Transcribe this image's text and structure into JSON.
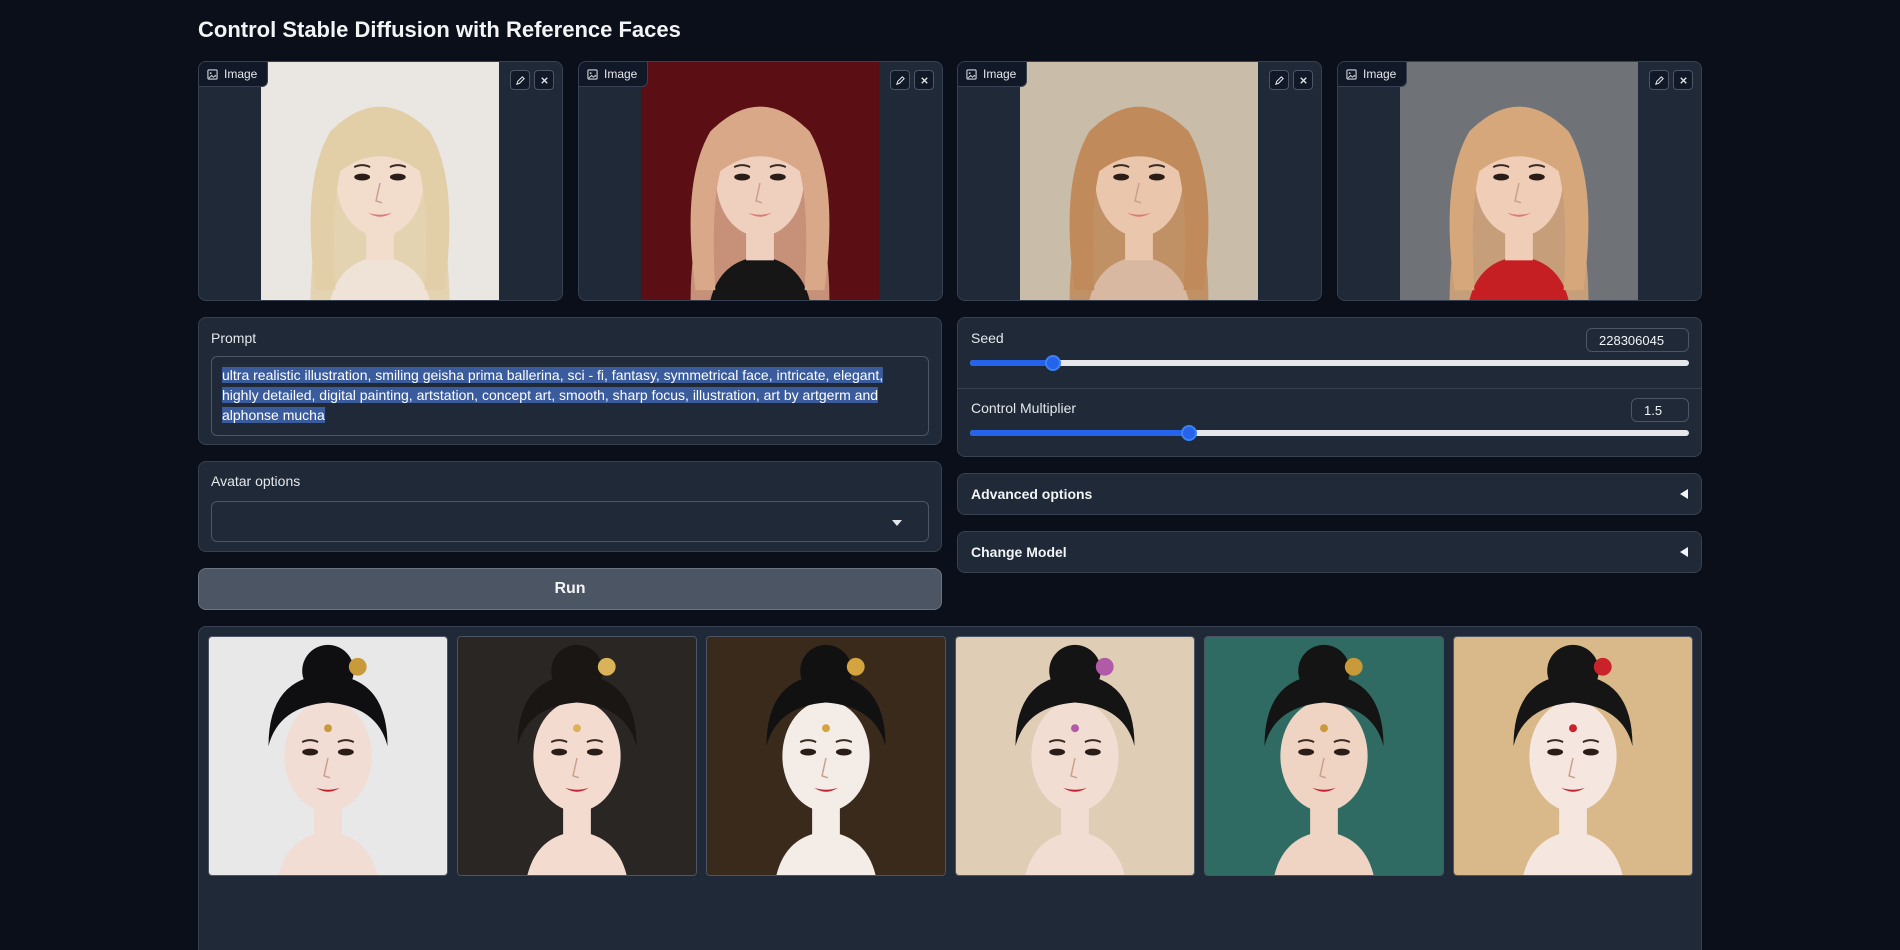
{
  "page": {
    "title": "Control Stable Diffusion with Reference Faces"
  },
  "reference_images": [
    {
      "label": "Image",
      "bg": "#eae7e3",
      "hair": "#e2cfa8",
      "skin": "#f2dccc",
      "top": "#efe2d6"
    },
    {
      "label": "Image",
      "bg": "#5b0f14",
      "hair": "#d9a889",
      "skin": "#efcfbe",
      "top": "#161616"
    },
    {
      "label": "Image",
      "bg": "#c9bca8",
      "hair": "#c08a5a",
      "skin": "#eac6ac",
      "top": "#d8b8a0"
    },
    {
      "label": "Image",
      "bg": "#6f7377",
      "hair": "#d6a77a",
      "skin": "#efcdb6",
      "top": "#c51f24"
    }
  ],
  "prompt": {
    "label": "Prompt",
    "value": "ultra realistic illustration, smiling geisha prima ballerina, sci - fi, fantasy, symmetrical face, intricate, elegant, highly detailed, digital painting, artstation, concept art, smooth, sharp focus, illustration, art by artgerm and alphonse mucha"
  },
  "avatar_options": {
    "label": "Avatar options",
    "value": ""
  },
  "run_button": {
    "label": "Run"
  },
  "seed": {
    "label": "Seed",
    "value": "228306045",
    "fraction": 0.115
  },
  "control_multiplier": {
    "label": "Control Multiplier",
    "value": "1.5",
    "fraction": 0.305
  },
  "advanced_options": {
    "label": "Advanced options"
  },
  "change_model": {
    "label": "Change Model"
  },
  "gallery": [
    {
      "bg": "#e8e8e8",
      "hair": "#0f0f12",
      "skin": "#f1ddd3",
      "accent": "#c89a3a"
    },
    {
      "bg": "#2a2623",
      "hair": "#1a1614",
      "skin": "#f3dccf",
      "accent": "#d9b25a"
    },
    {
      "bg": "#3a2a1c",
      "hair": "#111111",
      "skin": "#f4ece6",
      "accent": "#d4a441"
    },
    {
      "bg": "#e0cdb6",
      "hair": "#141414",
      "skin": "#f2ddd2",
      "accent": "#b05aa8"
    },
    {
      "bg": "#2f6b62",
      "hair": "#141414",
      "skin": "#efd4c4",
      "accent": "#c89a3a"
    },
    {
      "bg": "#d9b98a",
      "hair": "#151515",
      "skin": "#f5e6e0",
      "accent": "#c9222b"
    }
  ],
  "icons": {
    "image": "image-icon",
    "edit": "pencil-icon",
    "clear": "close-icon",
    "dropdown": "chevron-down-icon",
    "collapse": "triangle-left-icon"
  },
  "colors": {
    "accent": "#2563eb",
    "background": "#0b0f19",
    "panel": "#1f2937"
  }
}
